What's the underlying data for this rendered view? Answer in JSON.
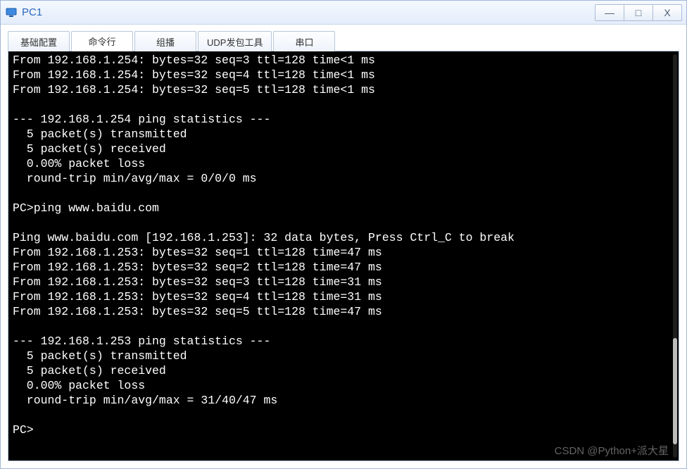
{
  "window": {
    "title": "PC1",
    "icon": "ensp-pc-icon"
  },
  "controls": {
    "minimize": "—",
    "maximize": "□",
    "close": "X"
  },
  "tabs": [
    {
      "id": "basic",
      "label": "基础配置",
      "active": false
    },
    {
      "id": "cmdline",
      "label": "命令行",
      "active": true
    },
    {
      "id": "mcast",
      "label": "组播",
      "active": false
    },
    {
      "id": "udp",
      "label": "UDP发包工具",
      "active": false
    },
    {
      "id": "serial",
      "label": "串口",
      "active": false
    }
  ],
  "terminal": {
    "prompt": "PC>",
    "lines": [
      "From 192.168.1.254: bytes=32 seq=3 ttl=128 time<1 ms",
      "From 192.168.1.254: bytes=32 seq=4 ttl=128 time<1 ms",
      "From 192.168.1.254: bytes=32 seq=5 ttl=128 time<1 ms",
      "",
      "--- 192.168.1.254 ping statistics ---",
      "  5 packet(s) transmitted",
      "  5 packet(s) received",
      "  0.00% packet loss",
      "  round-trip min/avg/max = 0/0/0 ms",
      "",
      "PC>ping www.baidu.com",
      "",
      "Ping www.baidu.com [192.168.1.253]: 32 data bytes, Press Ctrl_C to break",
      "From 192.168.1.253: bytes=32 seq=1 ttl=128 time=47 ms",
      "From 192.168.1.253: bytes=32 seq=2 ttl=128 time=47 ms",
      "From 192.168.1.253: bytes=32 seq=3 ttl=128 time=31 ms",
      "From 192.168.1.253: bytes=32 seq=4 ttl=128 time=31 ms",
      "From 192.168.1.253: bytes=32 seq=5 ttl=128 time=47 ms",
      "",
      "--- 192.168.1.253 ping statistics ---",
      "  5 packet(s) transmitted",
      "  5 packet(s) received",
      "  0.00% packet loss",
      "  round-trip min/avg/max = 31/40/47 ms",
      "",
      "PC>"
    ]
  },
  "watermark": "CSDN @Python+派大星"
}
